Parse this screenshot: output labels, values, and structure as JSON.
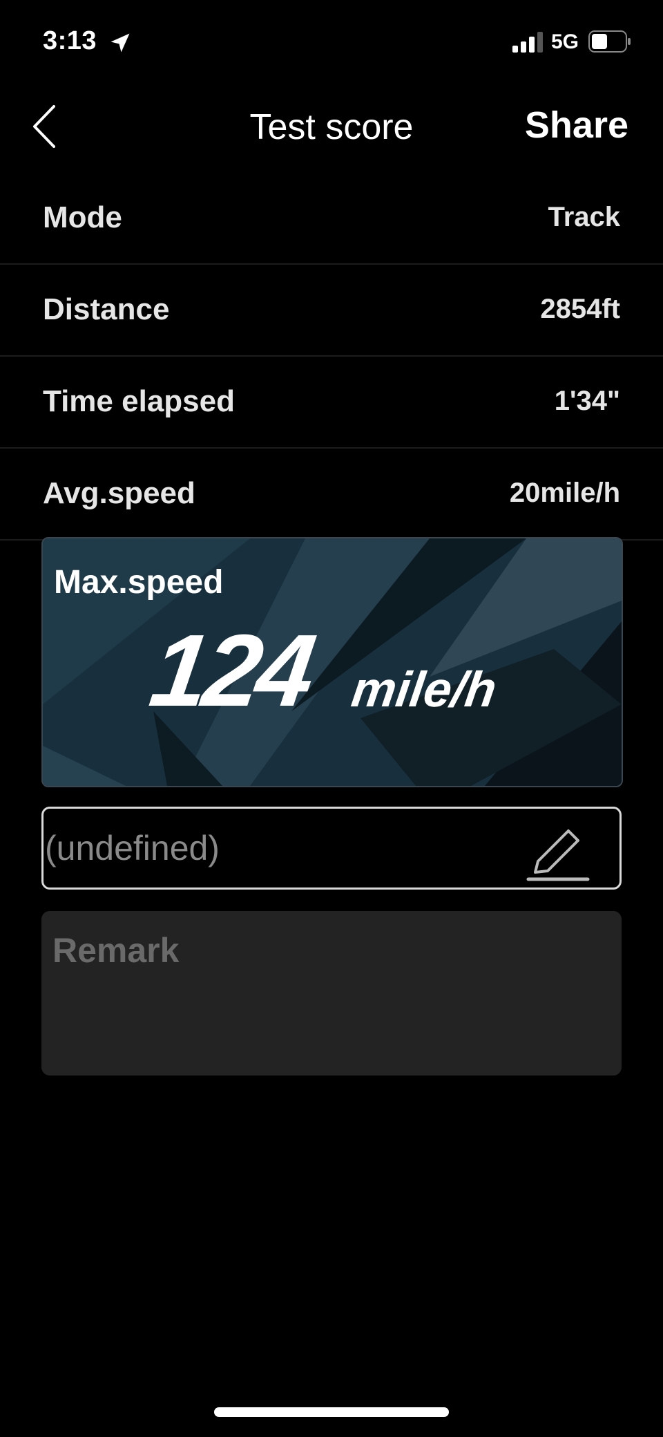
{
  "status_bar": {
    "time": "3:13",
    "network": "5G",
    "location_icon": "location-arrow-icon",
    "signal_icon": "cellular-signal-icon",
    "battery_icon": "battery-icon"
  },
  "nav": {
    "back_icon": "chevron-left-icon",
    "title": "Test score",
    "share_label": "Share"
  },
  "info_rows": [
    {
      "label": "Mode",
      "value": "Track"
    },
    {
      "label": "Distance",
      "value": "2854ft"
    },
    {
      "label": "Time elapsed",
      "value": "1'34\""
    },
    {
      "label": "Avg.speed",
      "value": "20mile/h"
    }
  ],
  "max_speed": {
    "label": "Max.speed",
    "value": "124",
    "unit": "mile/h"
  },
  "name_field": {
    "value": "(undefined)",
    "icon": "pencil-edit-icon"
  },
  "remark": {
    "placeholder": "Remark"
  },
  "colors": {
    "background": "#000000",
    "card_background": "#17313f",
    "remark_background": "#232323"
  }
}
